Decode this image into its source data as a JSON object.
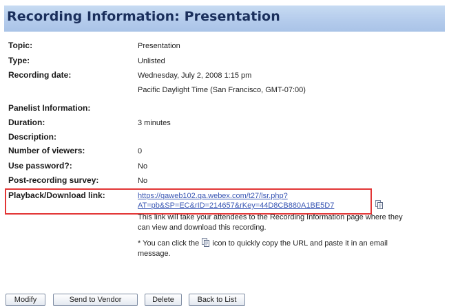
{
  "title": "Recording Information: Presentation",
  "fields": [
    {
      "label": "Topic:",
      "value": "Presentation"
    },
    {
      "label": "Type:",
      "value": "Unlisted"
    },
    {
      "label": "Recording date:",
      "value": "Wednesday, July 2, 2008 1:15 pm",
      "value2": "Pacific Daylight Time (San Francisco, GMT-07:00)"
    },
    {
      "label": "Panelist Information:",
      "value": ""
    },
    {
      "label": "Duration:",
      "value": "3 minutes"
    },
    {
      "label": "Description:",
      "value": ""
    },
    {
      "label": "Number of viewers:",
      "value": "0"
    },
    {
      "label": "Use password?:",
      "value": "No"
    },
    {
      "label": "Post-recording survey:",
      "value": "No"
    }
  ],
  "playback": {
    "label": "Playback/Download link:",
    "url_line1": "https://qaweb102.qa.webex.com/t27/lsr.php?",
    "url_line2": "AT=pb&SP=EC&rID=214657&rKey=44D8CB880A1BE5D7",
    "copy_icon": "copy-icon",
    "info_line1": "This link will take your attendees to the Recording Information page where they",
    "info_line2": "can view and download this recording.",
    "tip_prefix": "* You can click the",
    "tip_suffix": "icon to quickly copy the URL and paste it in an email",
    "tip_line2": "message."
  },
  "buttons": {
    "modify": "Modify",
    "send_to_vendor": "Send to Vendor",
    "delete": "Delete",
    "back_to_list": "Back to List"
  },
  "colors": {
    "header_bg": "#b5ccec",
    "header_text": "#1a2f5c",
    "link": "#3a57b4",
    "highlight": "#e23535"
  }
}
